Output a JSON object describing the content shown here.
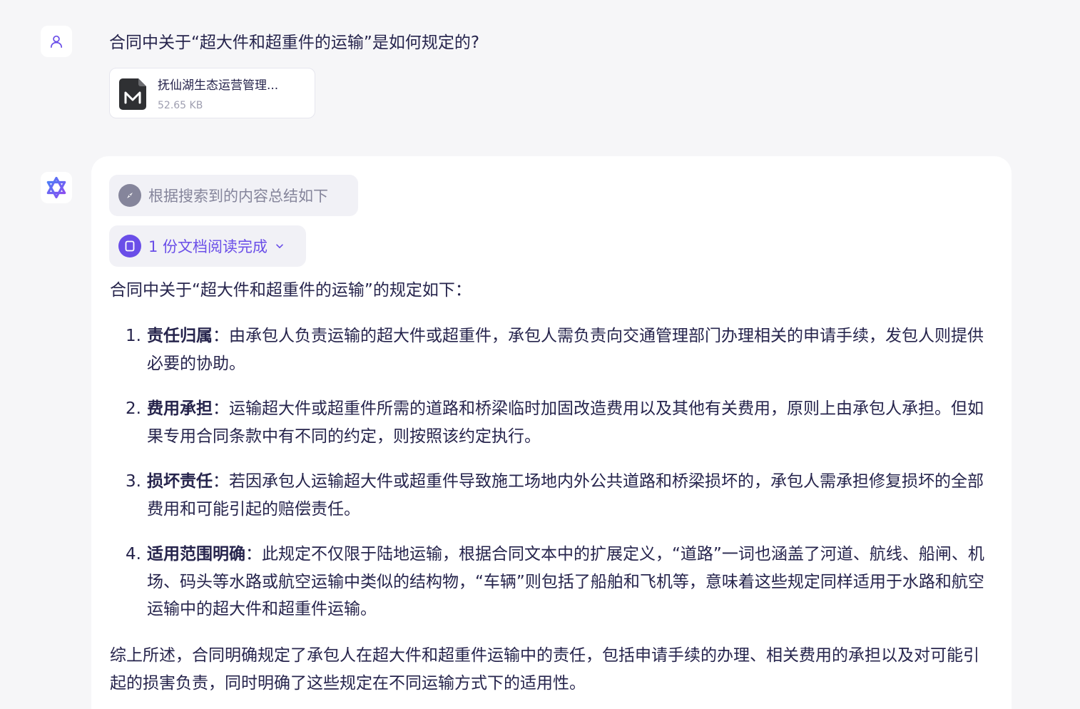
{
  "conversation": {
    "user": {
      "question": "合同中关于“超大件和超重件的运输”是如何规定的?",
      "attachment": {
        "icon": "markdown-file-icon",
        "name": "抚仙湖生态运营管理...",
        "size": "52.65 KB"
      }
    },
    "assistant": {
      "search_status": "根据搜索到的内容总结如下",
      "docs_status": "1 份文档阅读完成",
      "intro": "合同中关于“超大件和超重件的运输”的规定如下：",
      "points": [
        {
          "num": "1.",
          "title": "责任归属",
          "sep": "：",
          "text": "由承包人负责运输的超大件或超重件，承包人需负责向交通管理部门办理相关的申请手续，发包人则提供必要的协助。"
        },
        {
          "num": "2.",
          "title": "费用承担",
          "sep": "：",
          "text": "运输超大件或超重件所需的道路和桥梁临时加固改造费用以及其他有关费用，原则上由承包人承担。但如果专用合同条款中有不同的约定，则按照该约定执行。"
        },
        {
          "num": "3.",
          "title": "损坏责任",
          "sep": "：",
          "text": "若因承包人运输超大件或超重件导致施工场地内外公共道路和桥梁损坏的，承包人需承担修复损坏的全部费用和可能引起的赔偿责任。"
        },
        {
          "num": "4.",
          "title": "适用范围明确",
          "sep": "：",
          "text": "此规定不仅限于陆地运输，根据合同文本中的扩展定义，“道路”一词也涵盖了河道、航线、船闸、机场、码头等水路或航空运输中类似的结构物，“车辆”则包括了船舶和飞机等，意味着这些规定同样适用于水路和航空运输中的超大件和超重件运输。"
        }
      ],
      "summary": "综上所述，合同明确规定了承包人在超大件和超重件运输中的责任，包括申请手续的办理、相关费用的承担以及对可能引起的损害负责，同时明确了这些规定在不同运输方式下的适用性。"
    }
  },
  "colors": {
    "background": "#f6f6f8",
    "text": "#26244c",
    "muted": "#85859b",
    "accent": "#6a4ee8"
  }
}
